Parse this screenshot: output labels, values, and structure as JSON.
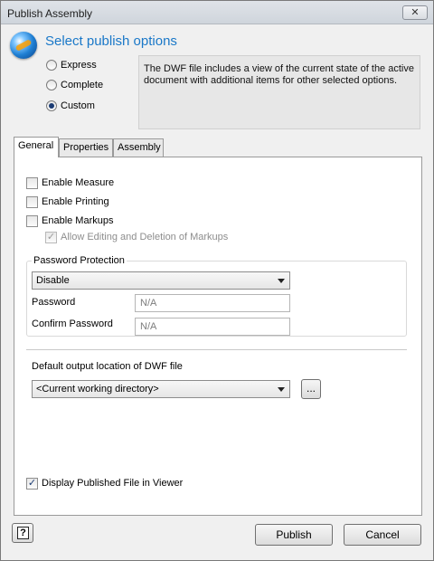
{
  "window": {
    "title": "Publish Assembly",
    "close_label": "✕"
  },
  "header": {
    "title": "Select publish options"
  },
  "options": [
    {
      "label": "Express",
      "selected": false
    },
    {
      "label": "Complete",
      "selected": false
    },
    {
      "label": "Custom",
      "selected": true
    }
  ],
  "description": "The DWF file includes a view of the current state of the active document with additional items for other selected options.",
  "tabs": [
    {
      "label": "General",
      "active": true
    },
    {
      "label": "Properties",
      "active": false
    },
    {
      "label": "Assembly",
      "active": false
    }
  ],
  "general": {
    "enable_measure": {
      "label": "Enable Measure",
      "checked": false
    },
    "enable_printing": {
      "label": "Enable Printing",
      "checked": false
    },
    "enable_markups": {
      "label": "Enable Markups",
      "checked": false
    },
    "allow_editing": {
      "label": "Allow Editing and Deletion of Markups",
      "checked": true,
      "enabled": false
    },
    "password_protection": {
      "legend": "Password Protection",
      "mode": "Disable",
      "password_label": "Password",
      "password_value": "N/A",
      "confirm_label": "Confirm Password",
      "confirm_value": "N/A"
    },
    "output": {
      "label": "Default output location of DWF file",
      "value": "<Current working directory>",
      "browse_label": "..."
    },
    "display_in_viewer": {
      "label": "Display Published File in Viewer",
      "checked": true
    }
  },
  "footer": {
    "help_label": "?",
    "publish_label": "Publish",
    "cancel_label": "Cancel"
  }
}
